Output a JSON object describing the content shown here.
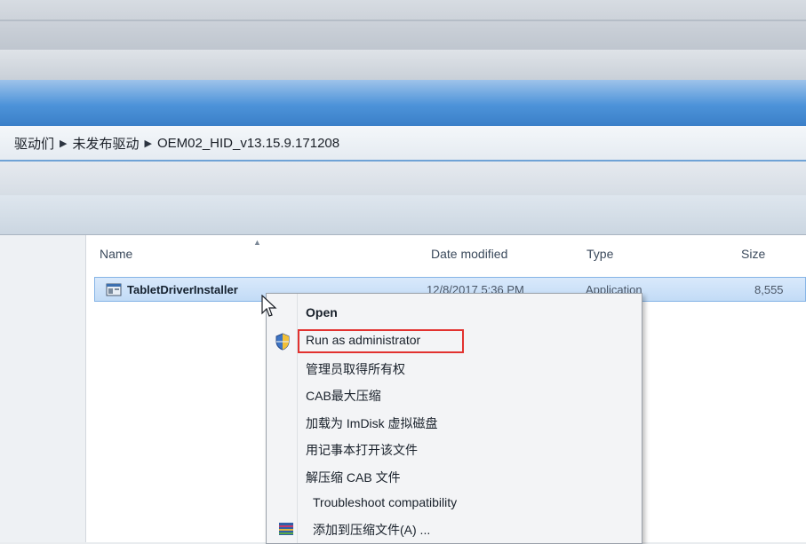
{
  "address": {
    "crumbs": [
      "驱动们",
      "未发布驱动",
      "OEM02_HID_v13.15.9.171208"
    ]
  },
  "columns": {
    "name": "Name",
    "date_modified": "Date modified",
    "type": "Type",
    "size": "Size"
  },
  "file_row": {
    "name": "TabletDriverInstaller",
    "date_modified": "12/8/2017 5:36 PM",
    "type": "Application",
    "size": "8,555"
  },
  "context_menu": {
    "items": [
      "Open",
      "Run as administrator",
      "管理员取得所有权",
      "CAB最大压缩",
      "加载为 ImDisk 虚拟磁盘",
      "用记事本打开该文件",
      "解压缩 CAB 文件",
      "Troubleshoot compatibility",
      "添加到压缩文件(A) ..."
    ]
  },
  "colors": {
    "selection": "#c2dbf6",
    "highlight_box": "#e2322f",
    "ribbon_blue": "#4d93d9"
  },
  "icons": {
    "file": "application-installer-icon",
    "shield": "uac-shield-icon",
    "archive": "winrar-archive-icon"
  }
}
